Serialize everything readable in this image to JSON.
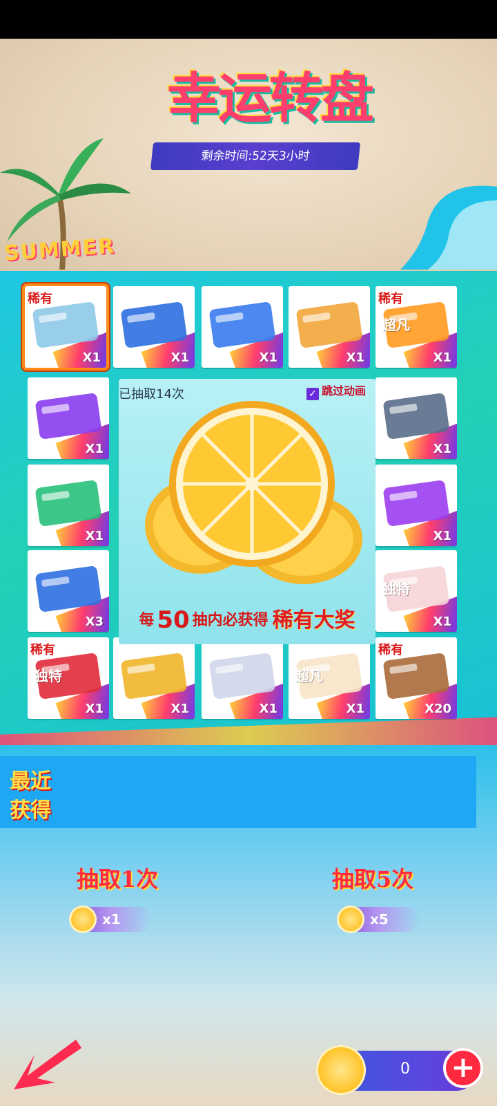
{
  "header": {
    "title": "幸运转盘",
    "remaining_time": "剩余时间:52天3小时",
    "banner_tag": "SUMMER"
  },
  "board": {
    "drawn_count": "已抽取14次",
    "skip_animation_label": "跳过动画",
    "skip_animation_checked": true,
    "guarantee_prefix": "每",
    "guarantee_number": "50",
    "guarantee_middle": "抽内必获得",
    "guarantee_prize": "稀有大奖",
    "tiles": [
      {
        "name": "tile-character-portrait",
        "qty": "X1",
        "rare": "稀有",
        "icon": "character-portrait-icon",
        "selected": true
      },
      {
        "name": "tile-gacha-ticket",
        "qty": "X1",
        "rare": "",
        "icon": "ticket-icon"
      },
      {
        "name": "tile-water-gun-blue",
        "qty": "X1",
        "rare": "",
        "icon": "water-gun-icon"
      },
      {
        "name": "tile-beach-card",
        "qty": "X1",
        "rare": "",
        "icon": "card-icon"
      },
      {
        "name": "tile-super-ticket-orange",
        "qty": "X1",
        "rare": "稀有",
        "icon": "ticket-icon",
        "text": "超凡"
      },
      {
        "name": "tile-purple-chest",
        "qty": "X1",
        "rare": "",
        "icon": "chest-icon"
      },
      {
        "name": "tile-blue-case",
        "qty": "X1",
        "rare": "",
        "icon": "briefcase-icon"
      },
      {
        "name": "tile-water-gun-green",
        "qty": "X1",
        "rare": "",
        "icon": "water-gun-icon"
      },
      {
        "name": "tile-water-gun-purple",
        "qty": "X1",
        "rare": "",
        "icon": "water-gun-icon"
      },
      {
        "name": "tile-gacha-ticket-2",
        "qty": "X3",
        "rare": "",
        "icon": "ticket-icon"
      },
      {
        "name": "tile-unique-ticket-pink",
        "qty": "X1",
        "rare": "",
        "icon": "ticket-icon",
        "text": "独特"
      },
      {
        "name": "tile-unique-ticket-red",
        "qty": "X1",
        "rare": "稀有",
        "icon": "ticket-icon",
        "text": "独特"
      },
      {
        "name": "tile-gold-chip",
        "qty": "X1",
        "rare": "",
        "icon": "chip-icon"
      },
      {
        "name": "tile-robot",
        "qty": "X1",
        "rare": "",
        "icon": "robot-icon"
      },
      {
        "name": "tile-super-ticket-cream",
        "qty": "X1",
        "rare": "",
        "icon": "ticket-icon",
        "text": "超凡"
      },
      {
        "name": "tile-bronze-plate",
        "qty": "X20",
        "rare": "稀有",
        "icon": "plate-icon"
      }
    ]
  },
  "recent": {
    "label_line1": "最近",
    "label_line2": "获得"
  },
  "draw": {
    "one_label": "抽取1次",
    "one_cost": "x1",
    "five_label": "抽取5次",
    "five_cost": "x5"
  },
  "footer": {
    "balance": "0"
  },
  "colors": {
    "accent_red": "#ff2a3f",
    "accent_yellow": "#ffd93b",
    "accent_purple": "#6a2bd8",
    "board_teal": "#1ec7e3"
  }
}
